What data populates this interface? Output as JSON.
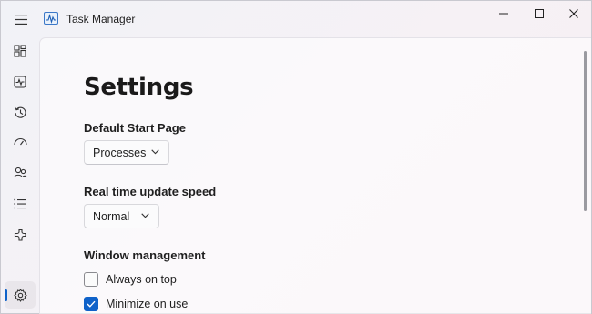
{
  "window": {
    "title": "Task Manager",
    "controls": [
      "minimize-icon",
      "maximize-icon",
      "close-icon"
    ]
  },
  "sidebar": {
    "items": [
      {
        "icon": "processes-icon"
      },
      {
        "icon": "performance-icon"
      },
      {
        "icon": "app-history-icon"
      },
      {
        "icon": "startup-apps-icon"
      },
      {
        "icon": "users-icon"
      },
      {
        "icon": "details-icon"
      },
      {
        "icon": "services-icon"
      },
      {
        "icon": "settings-icon",
        "active": true
      }
    ]
  },
  "settings": {
    "title": "Settings",
    "default_start_page": {
      "label": "Default Start Page",
      "value": "Processes"
    },
    "update_speed": {
      "label": "Real time update speed",
      "value": "Normal"
    },
    "window_management": {
      "label": "Window management",
      "options": [
        {
          "label": "Always on top",
          "checked": false
        },
        {
          "label": "Minimize on use",
          "checked": true
        }
      ]
    }
  },
  "colors": {
    "accent": "#0f62c9"
  }
}
